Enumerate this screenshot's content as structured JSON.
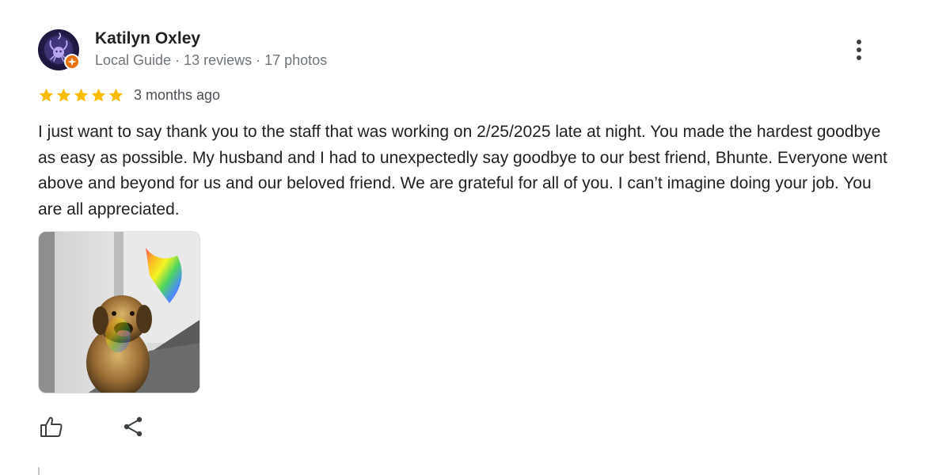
{
  "author": {
    "name": "Katilyn Oxley",
    "meta": "Local Guide · 13 reviews · 17 photos",
    "avatar_icon": "scorpion-avatar-icon",
    "badge_icon": "local-guide-star-icon",
    "badge_color": "#e8710a"
  },
  "review": {
    "rating": 5,
    "max_rating": 5,
    "star_color": "#fbbc04",
    "date": "3 months ago",
    "text": "I just want to say thank you to the staff that was working on 2/25/2025 late at night. You made the hardest goodbye as easy as possible. My husband and I had to unexpectedly say goodbye to our best friend, Bhunte. Everyone went above and beyond for us and our beloved friend. We are grateful for all of you. I can’t imagine doing your job. You are all appreciated."
  },
  "actions": {
    "more_icon": "more-vert-icon",
    "like_icon": "thumb-up-icon",
    "share_icon": "share-icon"
  }
}
